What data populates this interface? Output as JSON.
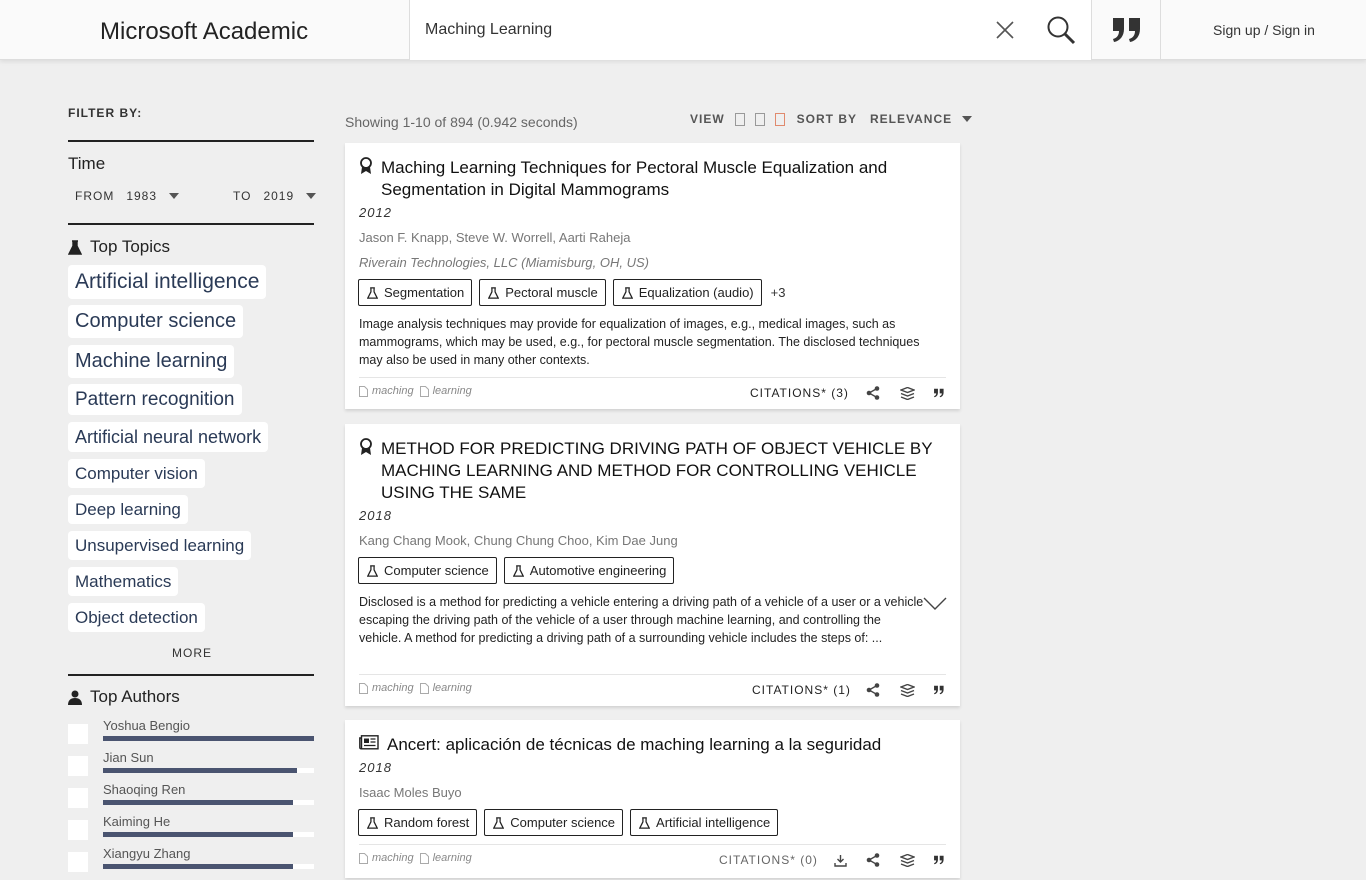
{
  "header": {
    "logo": "Microsoft Academic",
    "search_value": "Maching Learning",
    "signin": "Sign up / Sign in"
  },
  "filter": {
    "label": "FILTER BY:",
    "time": {
      "title": "Time",
      "from_label": "FROM",
      "from_value": "1983",
      "to_label": "TO",
      "to_value": "2019"
    },
    "topics_title": "Top Topics",
    "topics": [
      "Artificial intelligence",
      "Computer science",
      "Machine learning",
      "Pattern recognition",
      "Artificial neural network",
      "Computer vision",
      "Deep learning",
      "Unsupervised learning",
      "Mathematics",
      "Object detection"
    ],
    "more_label": "MORE",
    "authors_title": "Top Authors",
    "authors": [
      {
        "name": "Yoshua Bengio",
        "level": 1.0
      },
      {
        "name": "Jian Sun",
        "level": 0.92
      },
      {
        "name": "Shaoqing Ren",
        "level": 0.9
      },
      {
        "name": "Kaiming He",
        "level": 0.9
      },
      {
        "name": "Xiangyu Zhang",
        "level": 0.9
      }
    ]
  },
  "results": {
    "showing": "Showing 1-10 of 894 (0.942 seconds)",
    "view_label": "VIEW",
    "sort_label": "SORT BY",
    "sort_value": "RELEVANCE",
    "papers": [
      {
        "icon": "award-icon",
        "title": "Maching Learning Techniques for Pectoral Muscle Equalization and Segmentation in Digital Mammograms",
        "year": "2012",
        "authors": "Jason F. Knapp,  Steve W. Worrell,  Aarti Raheja",
        "affiliation": "Riverain Technologies, LLC (Miamisburg, OH, US)",
        "tags": [
          "Segmentation",
          "Pectoral muscle",
          "Equalization (audio)"
        ],
        "more_tags": "+3",
        "abstract": "Image analysis techniques may provide for equalization of images, e.g., medical images, such as mammograms, which may be used, e.g., for pectoral muscle segmentation. The disclosed techniques may also be used in many other contexts.",
        "keywords": [
          "maching",
          "learning"
        ],
        "citations": "CITATIONS* (3)"
      },
      {
        "icon": "award-icon",
        "title": "METHOD FOR PREDICTING DRIVING PATH OF OBJECT VEHICLE BY MACHING LEARNING AND METHOD FOR CONTROLLING VEHICLE USING THE SAME",
        "year": "2018",
        "authors": "Kang Chang Mook,  Chung Chung Choo,  Kim Dae Jung",
        "tags": [
          "Computer science",
          "Automotive engineering"
        ],
        "abstract": "Disclosed is a method for predicting a vehicle entering a driving path of a vehicle of a user or a vehicle escaping the driving path of the vehicle of a user through machine learning, and controlling the vehicle. A method for predicting a driving path of a surrounding vehicle includes the steps of: ...",
        "keywords": [
          "maching",
          "learning"
        ],
        "citations": "CITATIONS* (1)"
      },
      {
        "icon": "newspaper-icon",
        "title": "Ancert: aplicación de técnicas de maching learning a la seguridad",
        "year": "2018",
        "authors": "Isaac Moles Buyo",
        "tags": [
          "Random forest",
          "Computer science",
          "Artificial intelligence"
        ],
        "keywords": [
          "maching",
          "learning"
        ],
        "citations": "CITATIONS* (0)"
      }
    ]
  }
}
